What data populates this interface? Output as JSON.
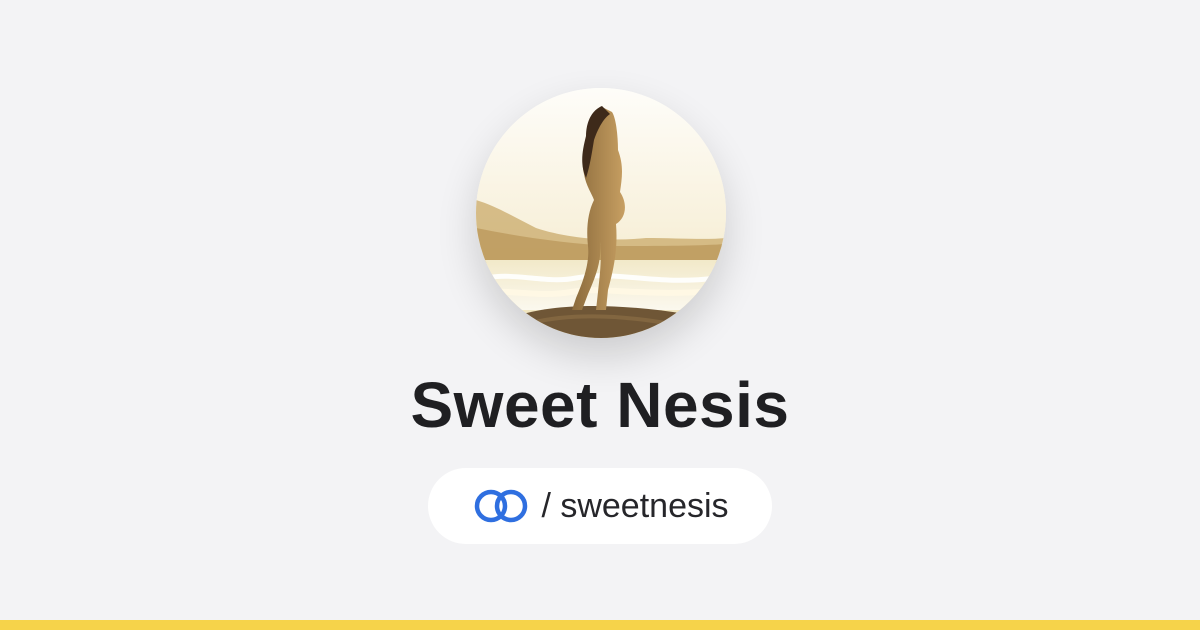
{
  "profile": {
    "name": "Sweet Nesis",
    "handle": "/ sweetnesis"
  },
  "icons": {
    "logo": "linked-rings-icon"
  },
  "colors": {
    "background": "#f3f3f5",
    "accent_bar": "#f6d34a",
    "logo_blue": "#2f6fe0"
  }
}
